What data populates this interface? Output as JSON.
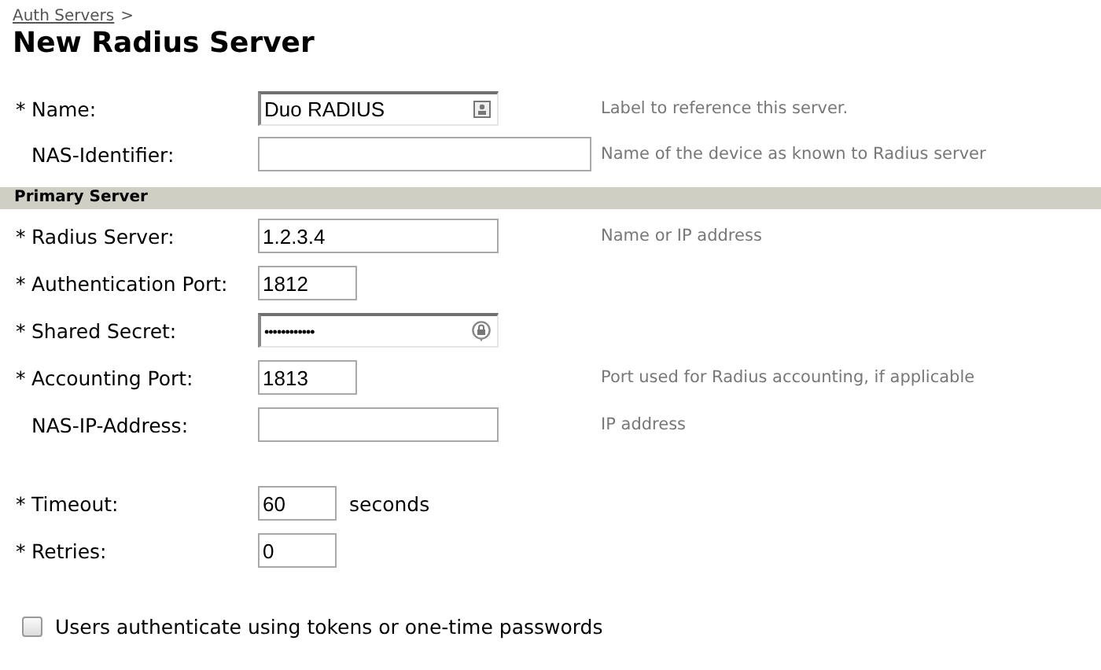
{
  "breadcrumb": {
    "link": "Auth Servers",
    "separator": ">"
  },
  "title": "New Radius Server",
  "general_fields": [
    {
      "required_mark": "*",
      "label": "Name:",
      "kind": "autofill",
      "value": "Duo RADIUS",
      "hint": "Label to reference this server."
    },
    {
      "label": "NAS-Identifier:",
      "kind": "long-text",
      "hint": "Name of the device as known to Radius server"
    }
  ],
  "primary_server": {
    "title": "Primary Server",
    "fields": [
      {
        "required_mark": "*",
        "label": "Radius Server:",
        "kind": "text",
        "value": "1.2.3.4",
        "hint": "Name or IP address"
      },
      {
        "required_mark": "*",
        "label": "Authentication Port:",
        "kind": "port",
        "value": "1812"
      },
      {
        "required_mark": "*",
        "label": "Shared Secret:",
        "kind": "password",
        "value": "••••••••••••"
      },
      {
        "required_mark": "*",
        "label": "Accounting Port:",
        "kind": "port",
        "value": "1813",
        "hint": "Port used for Radius accounting, if applicable"
      },
      {
        "label": "NAS-IP-Address:",
        "kind": "text",
        "hint": "IP address"
      }
    ]
  },
  "retry_fields": [
    {
      "required_mark": "*",
      "label": "Timeout:",
      "kind": "number",
      "value": "60",
      "unit": "seconds"
    },
    {
      "required_mark": "*",
      "label": "Retries:",
      "kind": "number",
      "value": "0"
    }
  ],
  "token_option": {
    "label": "Users authenticate using tokens or one-time passwords",
    "checked": false
  }
}
